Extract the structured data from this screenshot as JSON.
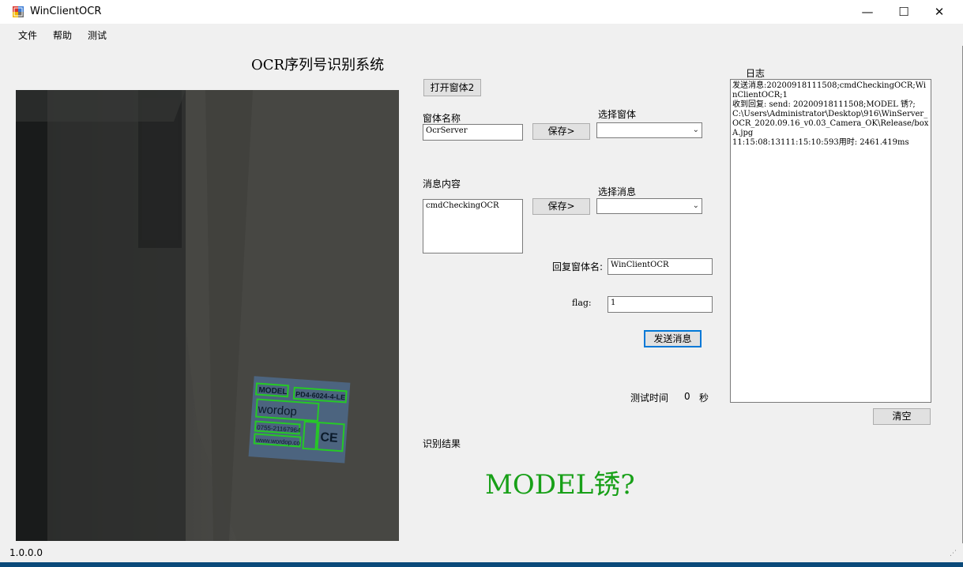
{
  "window": {
    "title": "WinClientOCR",
    "minimize": "—",
    "maximize": "☐",
    "close": "✕"
  },
  "menu": {
    "items": [
      "文件",
      "帮助",
      "测试"
    ]
  },
  "system_title": "OCR序列号识别系统",
  "buttons": {
    "open_window2": "打开窗体2",
    "save_window": "保存>",
    "save_message": "保存>",
    "send_message": "发送消息",
    "clear": "清空"
  },
  "form": {
    "window_name_label": "窗体名称",
    "window_name_value": "OcrServer",
    "select_window_label": "选择窗体",
    "select_window_value": "",
    "message_content_label": "消息内容",
    "message_content_value": "cmdCheckingOCR",
    "select_message_label": "选择消息",
    "select_message_value": "",
    "reply_window_label": "回复窗体名:",
    "reply_window_value": "WinClientOCR",
    "flag_label": "flag:",
    "flag_value": "1",
    "test_time_label": "测试时间",
    "test_time_value": "0",
    "test_time_unit": "秒"
  },
  "log": {
    "label": "日志",
    "lines": [
      "发送消息:20200918111508;cmdCheckingOCR;WinClientOCR;1",
      "收到回复: send: 20200918111508;MODEL 锈?;C:\\Users\\Administrator\\Desktop\\916\\WinServer_OCR_2020.09.16_v0.03_Camera_OK\\Release/boxA.jpg",
      "11:15:08:13111:15:10:593用时: 2461.419ms"
    ]
  },
  "result": {
    "label": "识别结果",
    "value": "MODEL锈?"
  },
  "preview": {
    "sticker_lines": [
      "MODEL",
      "PD4-6024-4-LE",
      "wordop",
      "0755-21167964",
      "www.wordop.co",
      "CE"
    ]
  },
  "status": {
    "version": "1.0.0.0"
  },
  "colors": {
    "result_text": "#18a018",
    "detect_box": "#26c926",
    "focus_border": "#0078d7"
  }
}
